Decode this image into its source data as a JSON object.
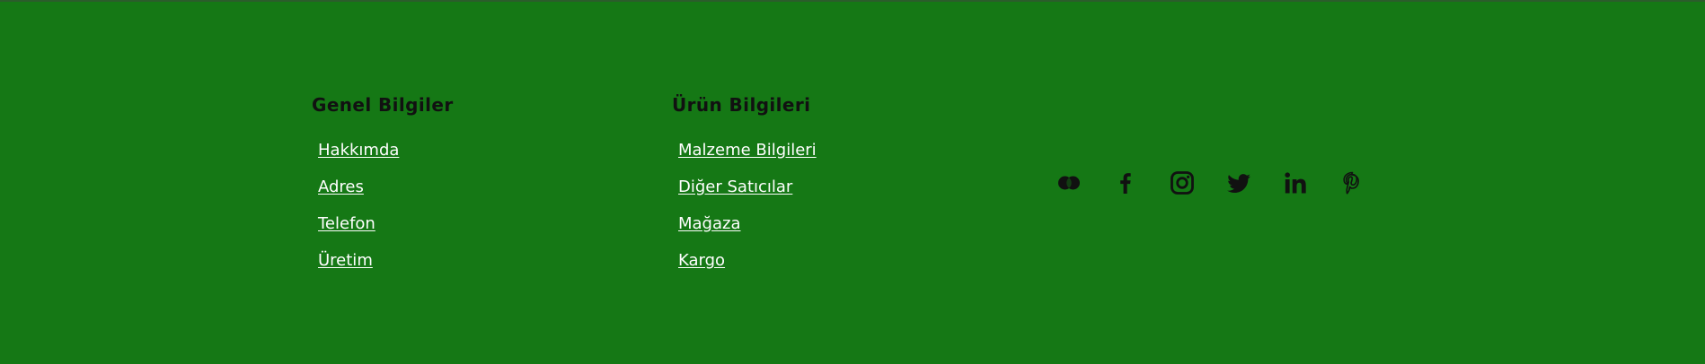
{
  "colors": {
    "background": "#157815",
    "heading": "#111111",
    "link": "#ffffff",
    "icon": "#111111"
  },
  "footer": {
    "columns": [
      {
        "title": "Genel Bilgiler",
        "links": [
          "Hakkımda",
          "Adres",
          "Telefon",
          "Üretim"
        ]
      },
      {
        "title": "Ürün Bilgileri",
        "links": [
          "Malzeme Bilgileri",
          "Diğer Satıcılar",
          "Mağaza",
          "Kargo"
        ]
      }
    ],
    "social": [
      "flickr-icon",
      "facebook-icon",
      "instagram-icon",
      "twitter-icon",
      "linkedin-icon",
      "pinterest-icon"
    ]
  }
}
